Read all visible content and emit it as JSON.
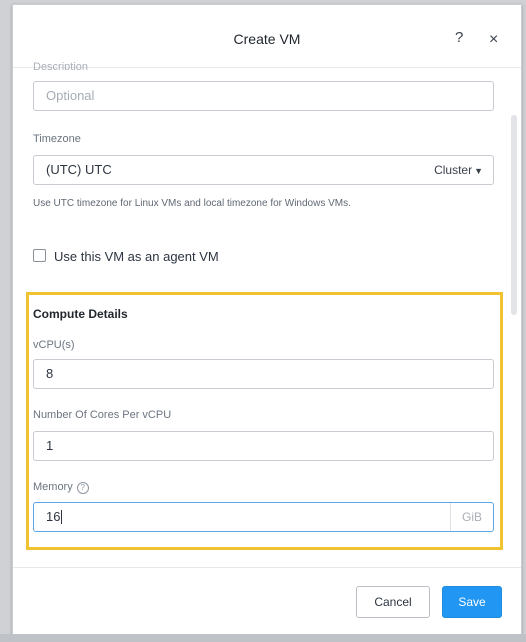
{
  "dialog": {
    "title": "Create VM",
    "help_glyph": "?",
    "close_glyph": "×"
  },
  "description": {
    "label": "Description",
    "placeholder": "Optional"
  },
  "timezone": {
    "label": "Timezone",
    "value": "(UTC) UTC",
    "scope_selected": "Cluster",
    "hint": "Use UTC timezone for Linux VMs and local timezone for Windows VMs."
  },
  "agent_vm": {
    "label": "Use this VM as an agent VM",
    "checked": false
  },
  "compute": {
    "title": "Compute Details",
    "vcpu": {
      "label": "vCPU(s)",
      "value": "8"
    },
    "cores": {
      "label": "Number Of Cores Per vCPU",
      "value": "1"
    },
    "memory": {
      "label": "Memory",
      "value": "16",
      "unit": "GiB",
      "help_glyph": "?"
    }
  },
  "footer": {
    "cancel_label": "Cancel",
    "save_label": "Save"
  },
  "colors": {
    "highlight": "#f1c232",
    "primary": "#2196f3",
    "focus_border": "#5aa6e8"
  },
  "icons": {
    "help": "question-mark-icon",
    "close": "close-icon",
    "dropdown": "chevron-down-icon",
    "info": "help-circle-icon"
  }
}
